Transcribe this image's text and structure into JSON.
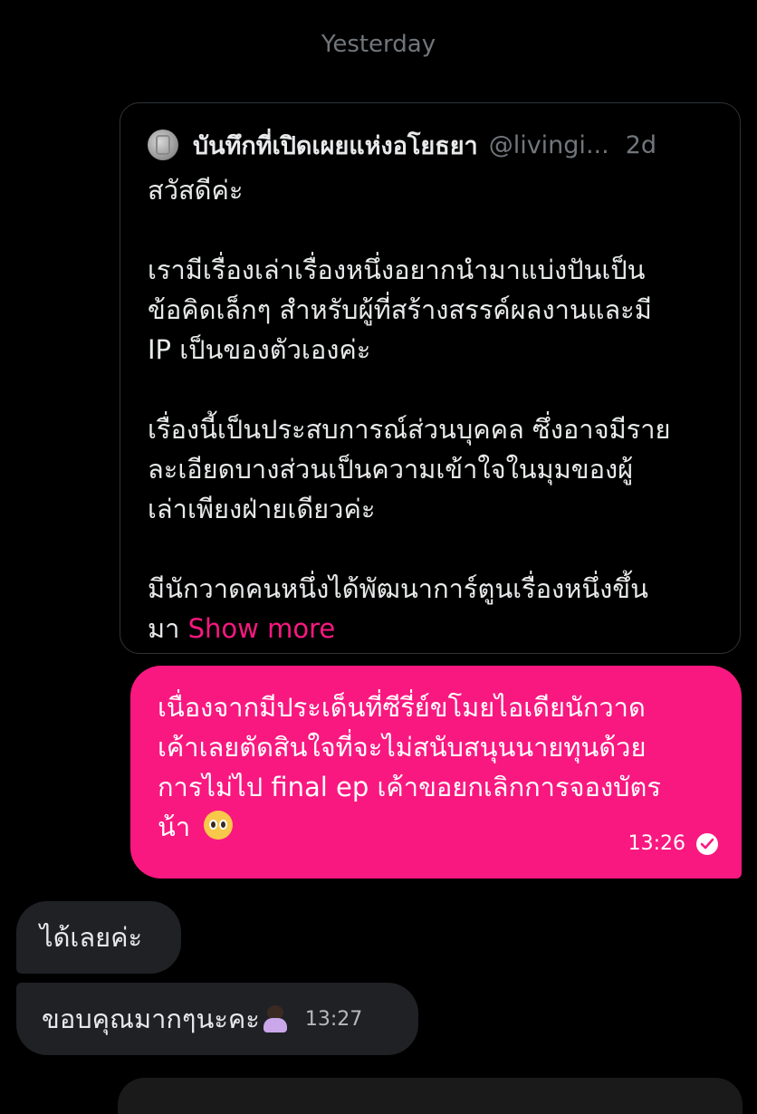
{
  "date_separator": "Yesterday",
  "quoted_post": {
    "author_name": "บันทึกที่เปิดเผยแห่งอโยธยา",
    "author_handle": "@livingi...",
    "time": "2d",
    "paragraphs": [
      [
        "สวัสดีค่ะ"
      ],
      [
        "เรามีเรื่องเล่าเรื่องหนึ่งอยากนำมาแบ่งปันเป็น",
        "ข้อคิดเล็กๆ สำหรับผู้ที่สร้างสรรค์ผลงานและมี",
        "IP เป็นของตัวเองค่ะ"
      ],
      [
        "เรื่องนี้เป็นประสบการณ์ส่วนบุคคล ซึ่งอาจมีราย",
        "ละเอียดบางส่วนเป็นความเข้าใจในมุมของผู้",
        "เล่าเพียงฝ่ายเดียวค่ะ"
      ],
      [
        "มีนักวาดคนหนึ่งได้พัฒนาการ์ตูนเรื่องหนึ่งขึ้น"
      ]
    ],
    "last_line_start": "มา",
    "show_more": "Show more"
  },
  "sent_message": {
    "lines": [
      "เนื่องจากมีประเด็นที่ซีรี่ย์ขโมยไอเดียนักวาด",
      "เค้าเลยตัดสินใจที่จะไม่สนับสนุนนายทุนด้วย",
      "การไม่ไป final ep เค้าขอยกเลิกการจองบัตร",
      "น้า"
    ],
    "emoji": "pleading-face-emoji",
    "time": "13:26",
    "status_icon": "check-circle-icon"
  },
  "received_messages": [
    {
      "text": "ได้เลยค่ะ",
      "time": ""
    },
    {
      "text": "ขอบคุณมากๆนะคะ",
      "emoji": "person-bowing-emoji",
      "time": "13:27"
    }
  ],
  "colors": {
    "background": "#000000",
    "sent_bubble": "#f91880",
    "received_bubble": "#1f2125",
    "link": "#f91880",
    "muted": "#71767b"
  }
}
